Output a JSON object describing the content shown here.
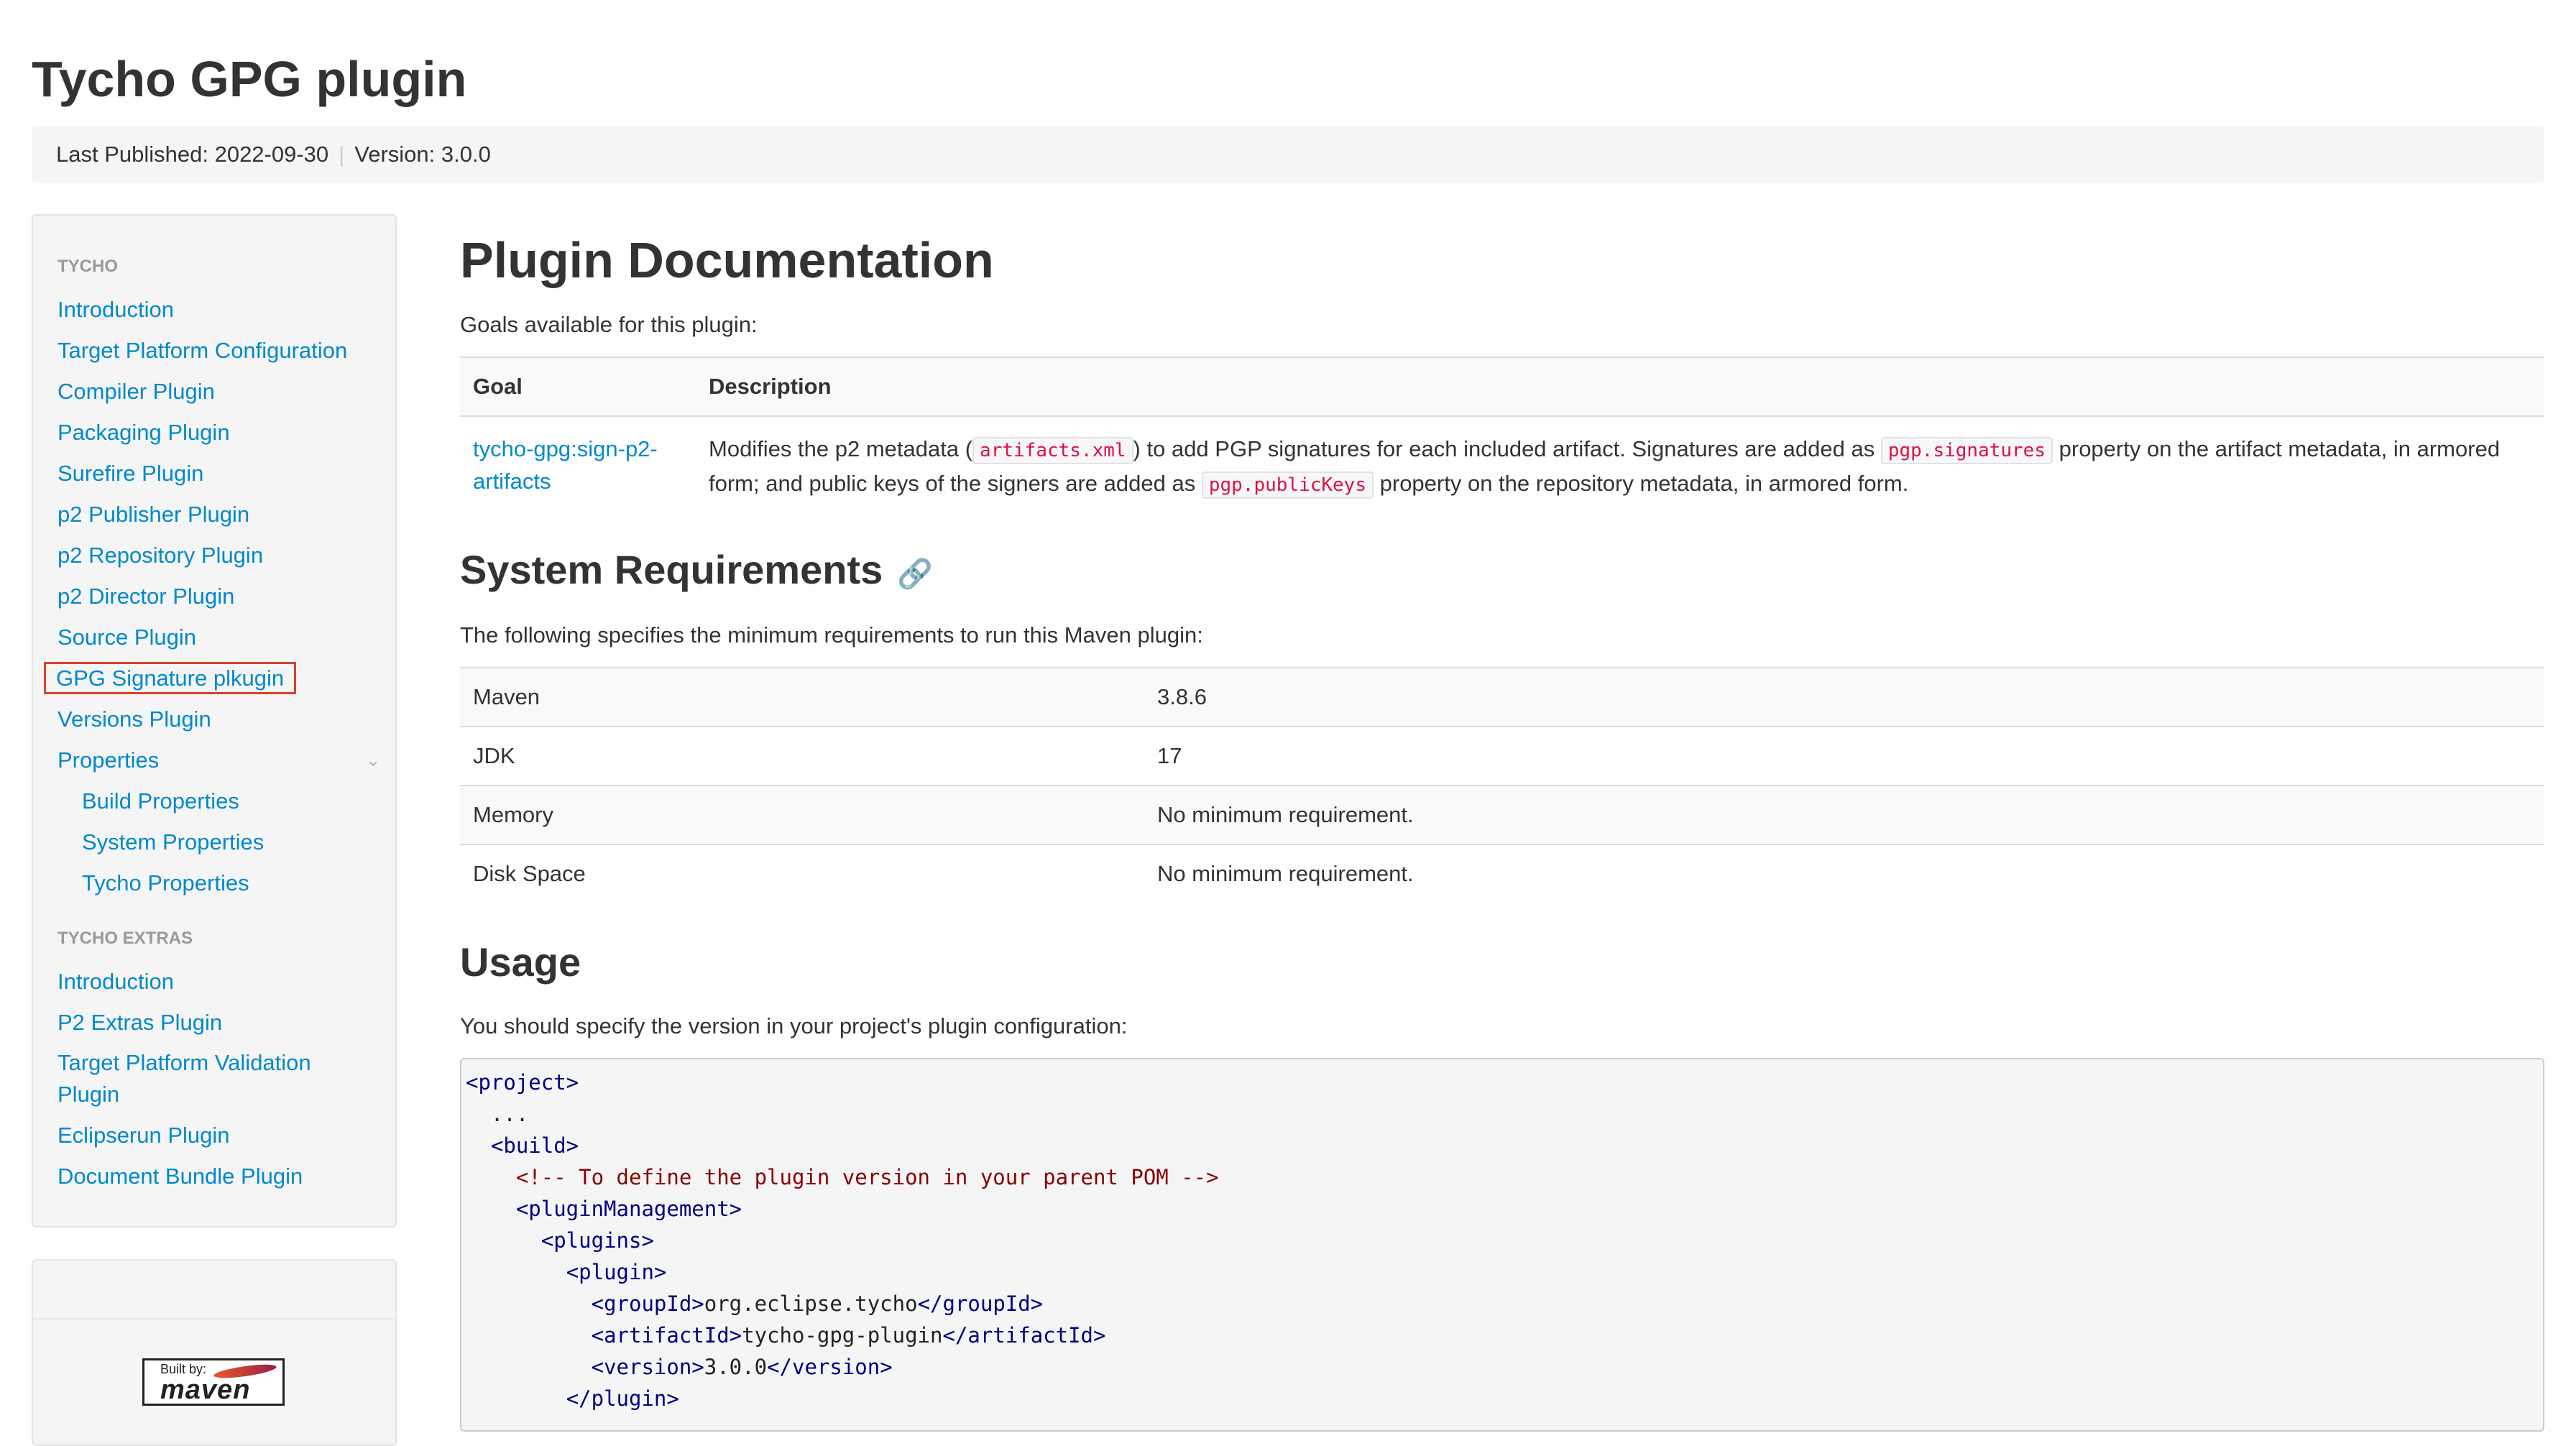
{
  "site": {
    "title": "Tycho GPG plugin",
    "last_published": "Last Published: 2022-09-30",
    "separator": "|",
    "version": "Version: 3.0.0"
  },
  "sidebar": {
    "header_1": "TYCHO",
    "items_1": [
      {
        "label": "Introduction"
      },
      {
        "label": "Target Platform Configuration"
      },
      {
        "label": "Compiler Plugin"
      },
      {
        "label": "Packaging Plugin"
      },
      {
        "label": "Surefire Plugin"
      },
      {
        "label": "p2 Publisher Plugin"
      },
      {
        "label": "p2 Repository Plugin"
      },
      {
        "label": "p2 Director Plugin"
      },
      {
        "label": "Source Plugin"
      },
      {
        "label": "GPG Signature plkugin",
        "active": true
      },
      {
        "label": "Versions Plugin"
      },
      {
        "label": "Properties",
        "expandable": true,
        "chevron_icon": "chevron-down-icon"
      }
    ],
    "subitems": [
      {
        "label": "Build Properties"
      },
      {
        "label": "System Properties"
      },
      {
        "label": "Tycho Properties"
      }
    ],
    "header_2": "TYCHO EXTRAS",
    "items_2": [
      {
        "label": "Introduction"
      },
      {
        "label": "P2 Extras Plugin"
      },
      {
        "label": "Target Platform Validation Plugin"
      },
      {
        "label": "Eclipserun Plugin"
      },
      {
        "label": "Document Bundle Plugin"
      }
    ],
    "built_by": {
      "by": "Built by:",
      "name": "maven"
    },
    "highlight_color": "#d9412c"
  },
  "main": {
    "title": "Plugin Documentation",
    "goals_intro": "Goals available for this plugin:",
    "goals_table": {
      "headers": [
        "Goal",
        "Description"
      ],
      "rows": [
        {
          "goal": "tycho-gpg:sign-p2-artifacts",
          "desc_1": "Modifies the p2 metadata (",
          "code_1": "artifacts.xml",
          "desc_2": ") to add PGP signatures for each included artifact. Signatures are added as",
          "code_2": "pgp.signatures",
          "desc_3": "property on the artifact metadata, in armored form; and public keys of the signers are added as",
          "code_3": "pgp.publicKeys",
          "desc_4": "property on the repository metadata, in armored form."
        }
      ]
    },
    "sysreq_title": "System Requirements",
    "sysreq_anchor_icon": "link-icon",
    "sysreq_intro": "The following specifies the minimum requirements to run this Maven plugin:",
    "sysreq_rows": [
      {
        "name": "Maven",
        "value": "3.8.6"
      },
      {
        "name": "JDK",
        "value": "17"
      },
      {
        "name": "Memory",
        "value": "No minimum requirement."
      },
      {
        "name": "Disk Space",
        "value": "No minimum requirement."
      }
    ],
    "usage_title": "Usage",
    "usage_intro": "You should specify the version in your project's plugin configuration:",
    "code_lines": [
      {
        "indent": "",
        "parts": [
          {
            "t": "tag",
            "v": "<project>"
          }
        ]
      },
      {
        "indent": "  ",
        "parts": [
          {
            "t": "txt",
            "v": "..."
          }
        ]
      },
      {
        "indent": "  ",
        "parts": [
          {
            "t": "tag",
            "v": "<build>"
          }
        ]
      },
      {
        "indent": "    ",
        "parts": [
          {
            "t": "cmt",
            "v": "<!-- To define the plugin version in your parent POM -->"
          }
        ]
      },
      {
        "indent": "    ",
        "parts": [
          {
            "t": "tag",
            "v": "<pluginManagement>"
          }
        ]
      },
      {
        "indent": "      ",
        "parts": [
          {
            "t": "tag",
            "v": "<plugins>"
          }
        ]
      },
      {
        "indent": "        ",
        "parts": [
          {
            "t": "tag",
            "v": "<plugin>"
          }
        ]
      },
      {
        "indent": "          ",
        "parts": [
          {
            "t": "tag",
            "v": "<groupId>"
          },
          {
            "t": "txt",
            "v": "org.eclipse.tycho"
          },
          {
            "t": "tag",
            "v": "</groupId>"
          }
        ]
      },
      {
        "indent": "          ",
        "parts": [
          {
            "t": "tag",
            "v": "<artifactId>"
          },
          {
            "t": "txt",
            "v": "tycho-gpg-plugin"
          },
          {
            "t": "tag",
            "v": "</artifactId>"
          }
        ]
      },
      {
        "indent": "          ",
        "parts": [
          {
            "t": "tag",
            "v": "<version>"
          },
          {
            "t": "txt",
            "v": "3.0.0"
          },
          {
            "t": "tag",
            "v": "</version>"
          }
        ]
      },
      {
        "indent": "        ",
        "parts": [
          {
            "t": "tag",
            "v": "</plugin>"
          }
        ]
      }
    ]
  }
}
